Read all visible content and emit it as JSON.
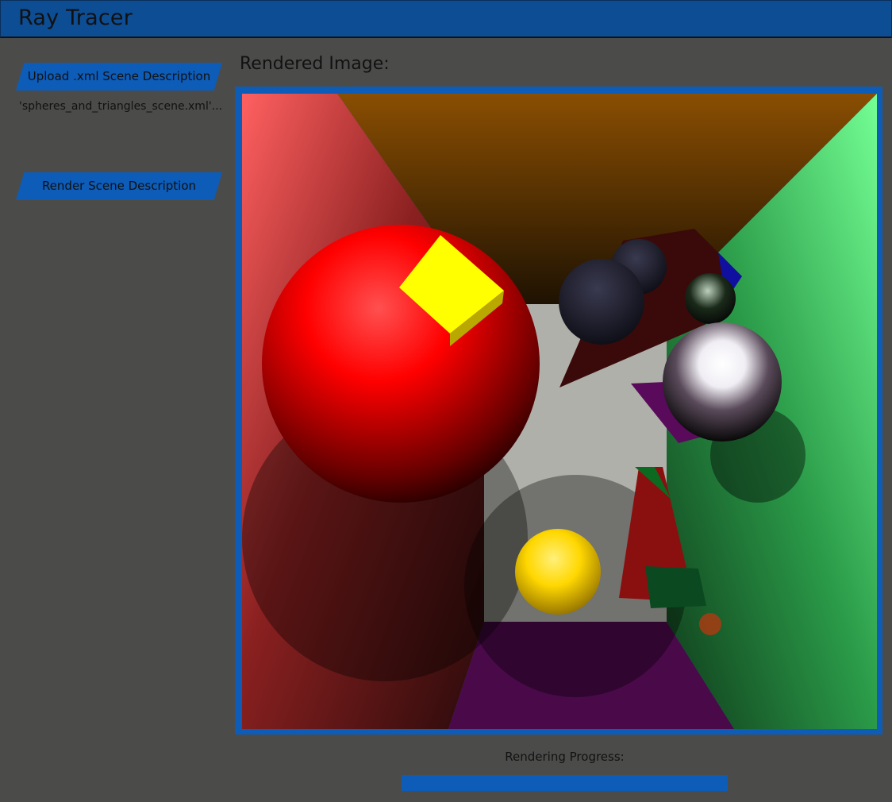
{
  "app": {
    "title": "Ray Tracer"
  },
  "sidebar": {
    "upload_label": "Upload .xml Scene Description",
    "filename": "'spheres_and_triangles_scene.xml'...",
    "render_label": "Render Scene Description"
  },
  "main": {
    "rendered_label": "Rendered Image:",
    "progress_label": "Rendering Progress:",
    "progress_fraction": 1.0
  },
  "colors": {
    "accent": "#0d5cb8",
    "titlebar": "#0d4d94",
    "background": "#4b4c4a"
  }
}
